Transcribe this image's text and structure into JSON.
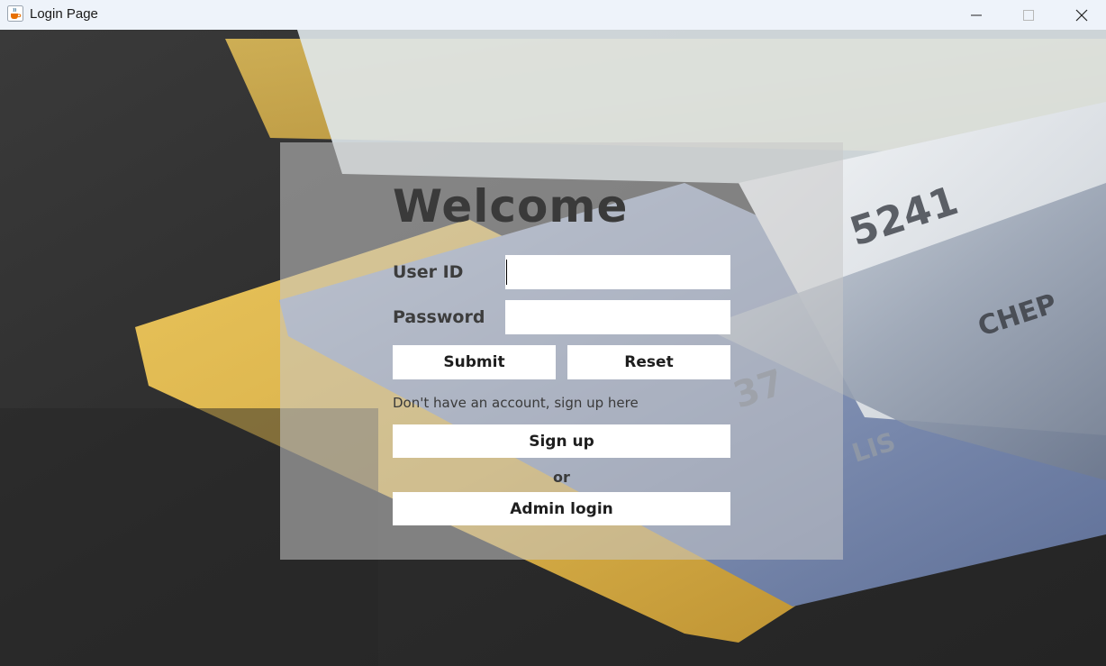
{
  "window": {
    "title": "Login Page",
    "icon": "java-cup-icon",
    "controls": [
      "minimize-icon",
      "maximize-icon",
      "close-icon"
    ]
  },
  "form": {
    "heading": "Welcome",
    "user_id_label": "User ID",
    "user_id_value": "",
    "password_label": "Password",
    "password_value": "",
    "submit_label": "Submit",
    "reset_label": "Reset",
    "signup_hint": "Don't have an account, sign up here",
    "signup_label": "Sign up",
    "or_text": "or",
    "admin_label": "Admin login"
  },
  "colors": {
    "titlebar": "#eef3fa",
    "panel_overlay": "rgba(200,200,200,0.55)",
    "label_text": "#3d3d3d",
    "button_bg": "#ffffff"
  }
}
